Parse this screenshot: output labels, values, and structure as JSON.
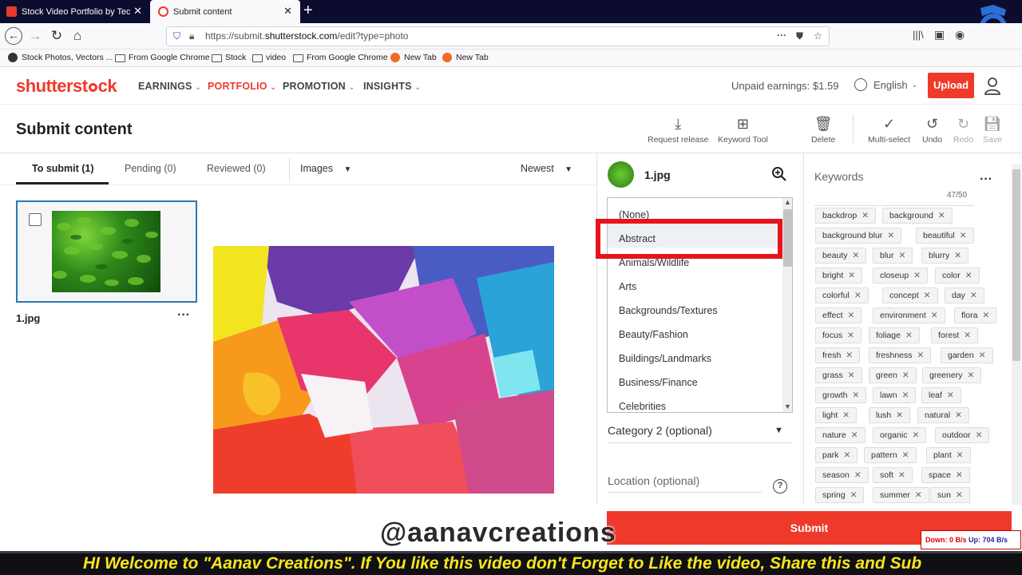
{
  "browser": {
    "tabs": [
      {
        "title": "Stock Video Portfolio by Techn"
      },
      {
        "title": "Submit content"
      }
    ],
    "url_prefix": "https://submit.",
    "url_domain": "shutterstock.com",
    "url_path": "/edit?type=photo",
    "bookmarks": [
      {
        "label": "Stock Photos, Vectors ..."
      },
      {
        "label": "From Google Chrome"
      },
      {
        "label": "Stock"
      },
      {
        "label": "video"
      },
      {
        "label": "From Google Chrome"
      },
      {
        "label": "New Tab"
      },
      {
        "label": "New Tab"
      }
    ]
  },
  "site": {
    "logo_a": "shutterst",
    "logo_b": "ck",
    "nav": [
      "EARNINGS",
      "PORTFOLIO",
      "PROMOTION",
      "INSIGHTS"
    ],
    "earnings": "Unpaid earnings: $1.59",
    "language": "English",
    "upload_label": "Upload"
  },
  "page": {
    "title": "Submit content",
    "tools": [
      "Request release",
      "Keyword Tool",
      "Delete",
      "Multi-select",
      "Undo",
      "Redo",
      "Save"
    ],
    "tabs": [
      "To submit (1)",
      "Pending (0)",
      "Reviewed (0)"
    ],
    "type_filter": "Images",
    "sort": "Newest",
    "thumb_name": "1.jpg"
  },
  "details": {
    "file_name": "1.jpg",
    "category_options": [
      "(None)",
      "Abstract",
      "Animals/Wildlife",
      "Arts",
      "Backgrounds/Textures",
      "Beauty/Fashion",
      "Buildings/Landmarks",
      "Business/Finance",
      "Celebrities"
    ],
    "category2_label": "Category 2 (optional)",
    "location_label": "Location (optional)"
  },
  "keywords": {
    "label": "Keywords",
    "count": "47/50",
    "rows": [
      [
        "backdrop",
        "background"
      ],
      [
        "background blur",
        "beautiful"
      ],
      [
        "beauty",
        "blur",
        "blurry"
      ],
      [
        "bright",
        "closeup",
        "color"
      ],
      [
        "colorful",
        "concept",
        "day"
      ],
      [
        "effect",
        "environment",
        "flora"
      ],
      [
        "focus",
        "foliage",
        "forest"
      ],
      [
        "fresh",
        "freshness",
        "garden"
      ],
      [
        "grass",
        "green",
        "greenery"
      ],
      [
        "growth",
        "lawn",
        "leaf"
      ],
      [
        "light",
        "lush",
        "natural"
      ],
      [
        "nature",
        "organic",
        "outdoor"
      ],
      [
        "park",
        "pattern",
        "plant"
      ],
      [
        "season",
        "soft",
        "space"
      ],
      [
        "spring",
        "summer",
        "sun"
      ]
    ]
  },
  "submit_label": "Submit",
  "watermark": "@aanavcreations",
  "netmeter": {
    "down": "Down: 0 B/s",
    "up": "Up: 704 B/s"
  },
  "ticker_text": "HI Welcome to \"Aanav Creations\". If You like this video don't Forget to Like the video, Share this and Sub",
  "colors": {
    "brand": "#ef3a2b",
    "highlight_box": "#e8141b",
    "ticker_text": "#f6e51a"
  }
}
